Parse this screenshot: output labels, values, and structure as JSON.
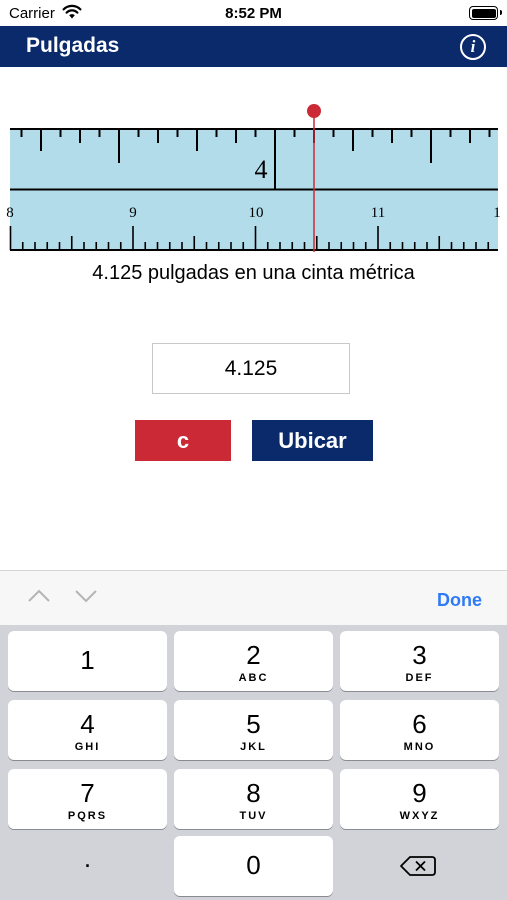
{
  "status": {
    "carrier": "Carrier",
    "time": "8:52 PM"
  },
  "nav": {
    "title": "Pulgadas",
    "info_glyph": "i",
    "info_icon": "info-icon"
  },
  "ruler": {
    "inch_label": "4",
    "cm_labels": [
      "8",
      "9",
      "10",
      "11",
      "1"
    ],
    "marker_value_inches": 4.125,
    "colors": {
      "tape": "#b3dcea",
      "marker": "#cc2936"
    }
  },
  "caption": "4.125 pulgadas en una cinta métrica",
  "input": {
    "value": "4.125"
  },
  "buttons": {
    "clear_label": "c",
    "locate_label": "Ubicar"
  },
  "accessory": {
    "done_label": "Done",
    "prev_icon": "chevron-up-icon",
    "next_icon": "chevron-down-icon"
  },
  "keypad": {
    "keys": [
      {
        "num": "1",
        "letters": ""
      },
      {
        "num": "2",
        "letters": "ABC"
      },
      {
        "num": "3",
        "letters": "DEF"
      },
      {
        "num": "4",
        "letters": "GHI"
      },
      {
        "num": "5",
        "letters": "JKL"
      },
      {
        "num": "6",
        "letters": "MNO"
      },
      {
        "num": "7",
        "letters": "PQRS"
      },
      {
        "num": "8",
        "letters": "TUV"
      },
      {
        "num": "9",
        "letters": "WXYZ"
      },
      {
        "num": "0",
        "letters": ""
      }
    ],
    "dot": ".",
    "delete_icon": "backspace-icon"
  },
  "colors": {
    "nav": "#0a2a6b",
    "accent_red": "#cc2936",
    "done_blue": "#2f7bf5",
    "keyboard_bg": "#d1d3d9"
  }
}
